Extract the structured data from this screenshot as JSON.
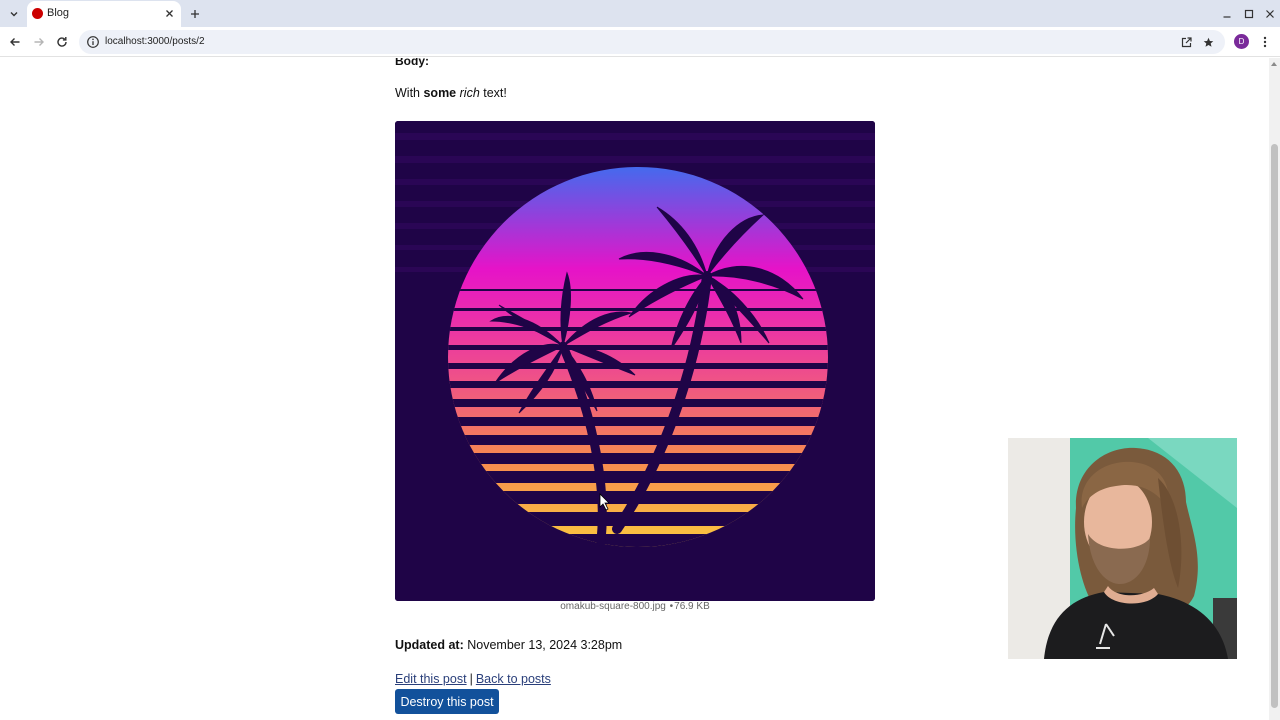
{
  "browser": {
    "tab_title": "Blog",
    "url": "localhost:3000/posts/2",
    "profile_initial": "D"
  },
  "post": {
    "body_label": "Body:",
    "body_prefix": "With ",
    "body_bold": "some",
    "body_space": " ",
    "body_italic": "rich",
    "body_suffix": " text!",
    "attachment": {
      "filename": "omakub-square-800.jpg",
      "separator": "•",
      "size": "76.9 KB"
    },
    "updated_label": "Updated at:",
    "updated_value": "November 13, 2024 3:28pm",
    "edit_link": "Edit this post",
    "link_separator": "|",
    "back_link": "Back to posts",
    "destroy_button": "Destroy this post"
  },
  "colors": {
    "tabbar_bg": "#dde3ef",
    "button_bg": "#12519b",
    "link": "#2a3f7a",
    "image_bg": "#1f0447"
  },
  "icons": [
    "tab-list-icon",
    "favicon-icon",
    "close-icon",
    "plus-icon",
    "minimize-icon",
    "maximize-icon",
    "window-close-icon",
    "back-arrow-icon",
    "forward-arrow-icon",
    "reload-icon",
    "info-icon",
    "open-external-icon",
    "star-icon",
    "more-vert-icon"
  ]
}
